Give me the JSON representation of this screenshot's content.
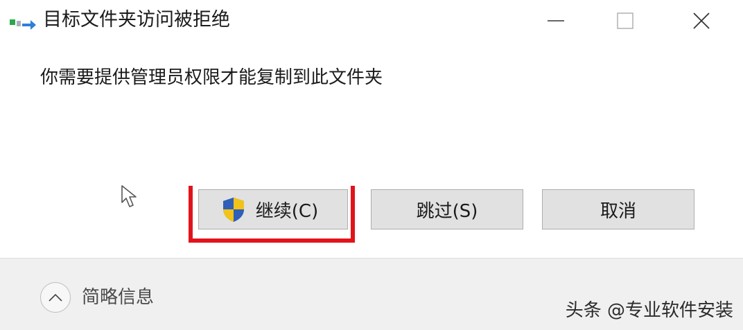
{
  "window": {
    "title": "目标文件夹访问被拒绝",
    "icon": "copy-move-icon",
    "controls": [
      "minimize-icon",
      "maximize-icon",
      "close-icon"
    ]
  },
  "message": "你需要提供管理员权限才能复制到此文件夹",
  "buttons": {
    "continue_label": "继续(C)",
    "continue_icon": "uac-shield-icon",
    "skip_label": "跳过(S)",
    "cancel_label": "取消"
  },
  "footer": {
    "details_label": "简略信息",
    "details_icon": "chevron-up-icon"
  },
  "watermark": "头条 @专业软件安装",
  "colors": {
    "highlight": "#e1141b",
    "button_bg": "#e1e1e1",
    "footer_bg": "#f0f0f0"
  }
}
